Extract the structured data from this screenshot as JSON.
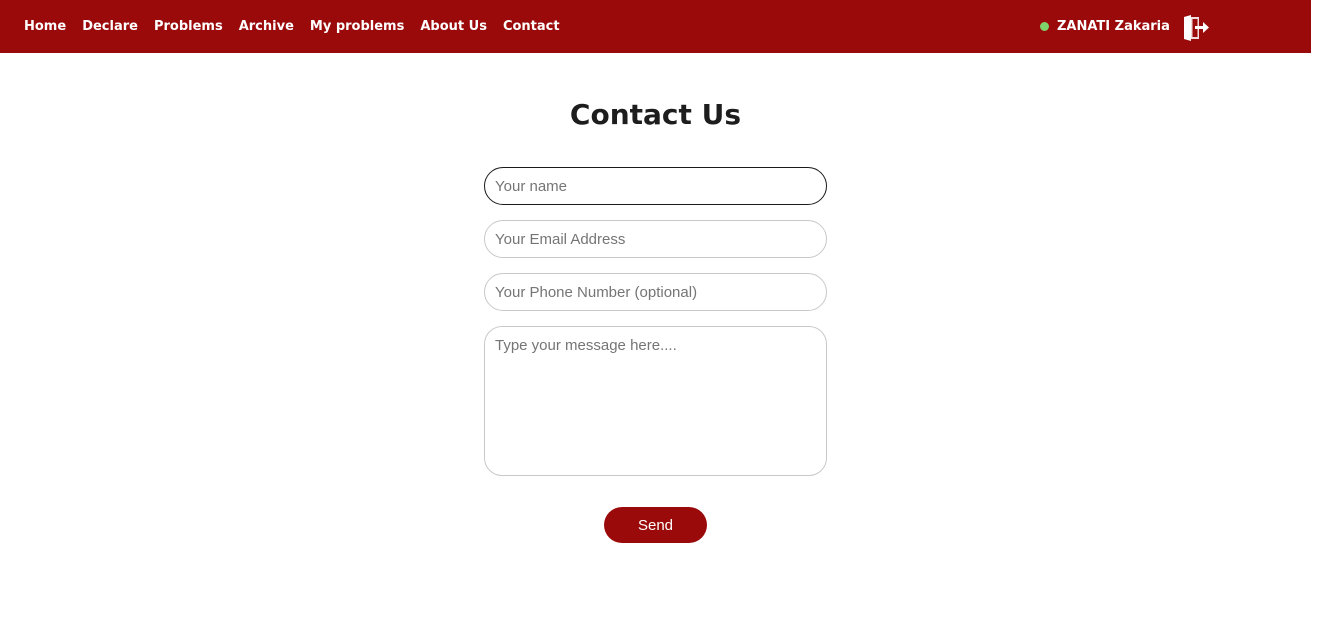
{
  "navbar": {
    "links": [
      "Home",
      "Declare",
      "Problems",
      "Archive",
      "My problems",
      "About Us",
      "Contact"
    ],
    "user_name": "ZANATI Zakaria",
    "status": "online",
    "logout_icon": "logout-door-icon",
    "bg_color": "#9b0a0b"
  },
  "page": {
    "title": "Contact Us"
  },
  "form": {
    "name_placeholder": "Your name",
    "email_placeholder": "Your Email Address",
    "phone_placeholder": "Your Phone Number (optional)",
    "message_placeholder": "Type your message here....",
    "send_label": "Send"
  }
}
